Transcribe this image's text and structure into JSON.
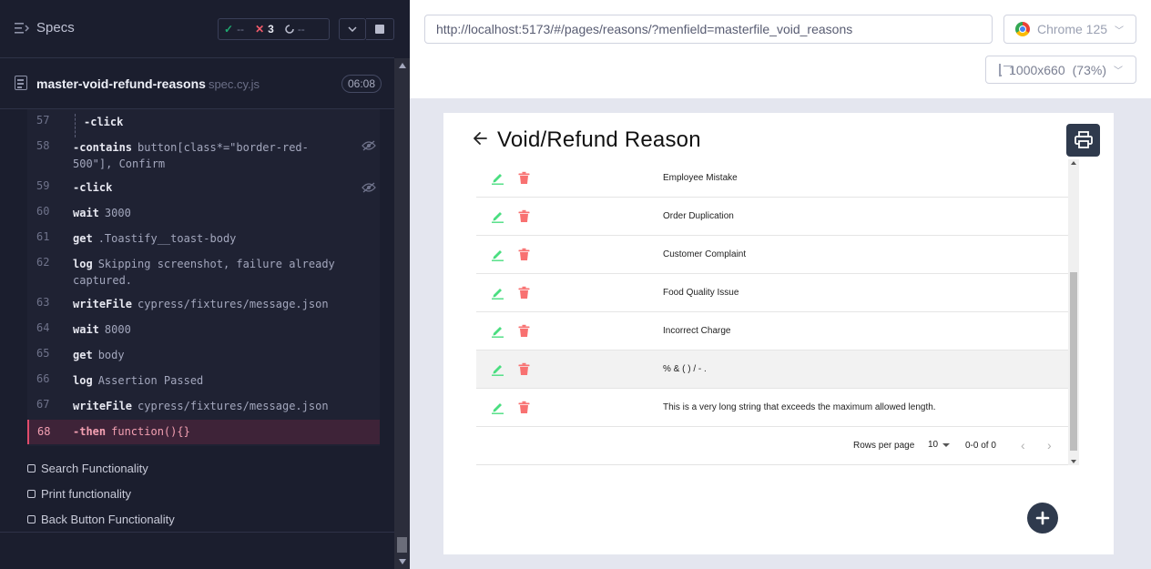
{
  "runner": {
    "specs_title": "Specs",
    "stats": {
      "passed": "--",
      "failed": "3",
      "pending": "--"
    },
    "spec_name": "master-void-refund-reasons",
    "spec_ext": "spec.cy.js",
    "duration": "06:08",
    "commands": [
      {
        "num": "57",
        "name": "-click",
        "arg": ""
      },
      {
        "num": "58",
        "name": "-contains",
        "arg": "button[class*=\"border-red-500\"], Confirm"
      },
      {
        "num": "59",
        "name": "-click",
        "arg": ""
      },
      {
        "num": "60",
        "name": "wait",
        "arg": "3000"
      },
      {
        "num": "61",
        "name": "get",
        "arg": ".Toastify__toast-body"
      },
      {
        "num": "62",
        "name": "log",
        "arg": "Skipping screenshot, failure already captured."
      },
      {
        "num": "63",
        "name": "writeFile",
        "arg": "cypress/fixtures/message.json"
      },
      {
        "num": "64",
        "name": "wait",
        "arg": "8000"
      },
      {
        "num": "65",
        "name": "get",
        "arg": "body"
      },
      {
        "num": "66",
        "name": "log",
        "arg": "Assertion Passed"
      },
      {
        "num": "67",
        "name": "writeFile",
        "arg": "cypress/fixtures/message.json"
      },
      {
        "num": "68",
        "name": "-then",
        "arg": "function(){}"
      }
    ],
    "tests": [
      "Search Functionality",
      "Print functionality",
      "Back Button Functionality"
    ]
  },
  "browser": {
    "url": "http://localhost:5173/#/pages/reasons/?menfield=masterfile_void_reasons",
    "browser_label": "Chrome 125",
    "viewport_label": "1000x660",
    "zoom_label": "(73%)"
  },
  "app": {
    "title": "Void/Refund Reason",
    "reasons": [
      "Employee Mistake",
      "Order Duplication",
      "Customer Complaint",
      "Food Quality Issue",
      "Incorrect Charge",
      "% & ( ) / - .",
      "This is a very long string that exceeds the maximum allowed length."
    ],
    "highlighted_row": 5,
    "pagination": {
      "rows_per_page_label": "Rows per page",
      "rows_per_page": "10",
      "range": "0-0 of 0"
    },
    "colors": {
      "edit": "#4ade80",
      "delete": "#f87171",
      "dark_button": "#2f3a4d"
    }
  }
}
